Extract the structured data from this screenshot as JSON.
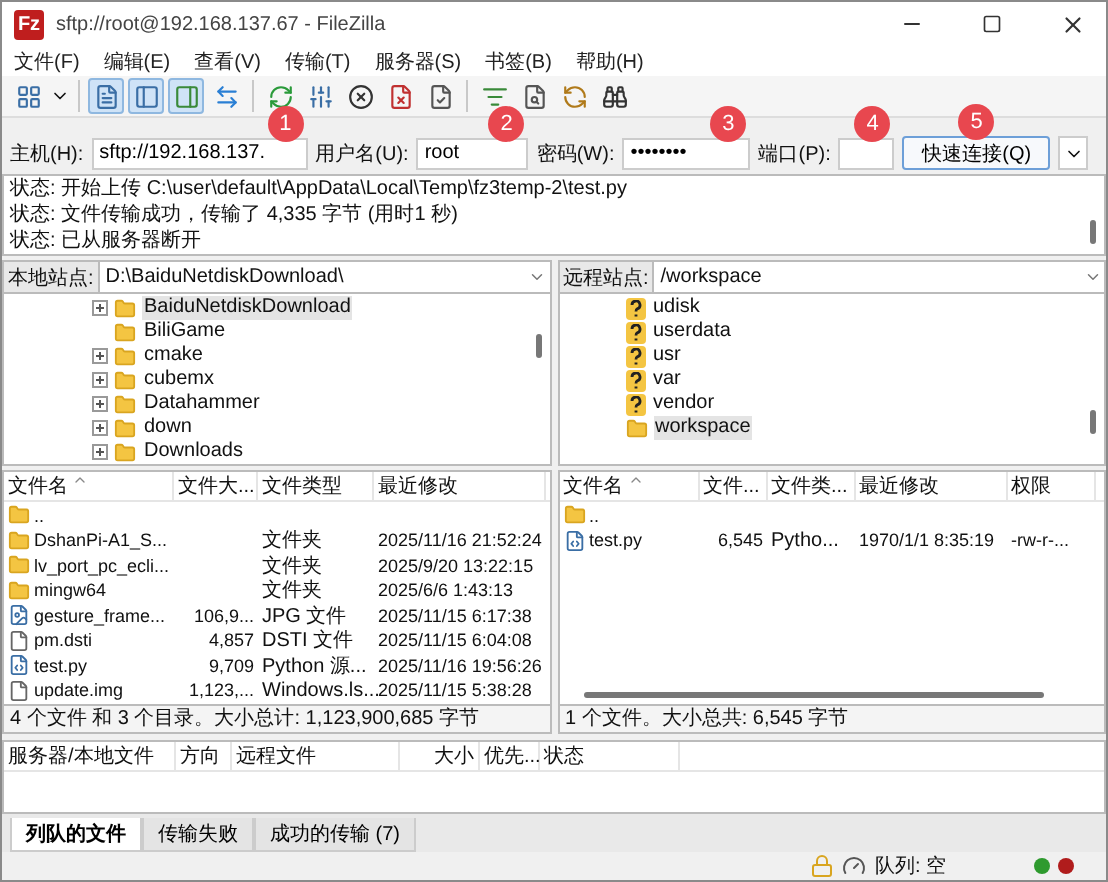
{
  "window": {
    "logo": "Fz",
    "title": "sftp://root@192.168.137.67 - FileZilla"
  },
  "menu": [
    "文件(F)",
    "编辑(E)",
    "查看(V)",
    "传输(T)",
    "服务器(S)",
    "书签(B)",
    "帮助(H)"
  ],
  "toolbar_toggles": [
    {
      "on": true
    },
    {
      "on": true
    },
    {
      "on": true
    },
    {
      "on": false
    }
  ],
  "quickconnect": {
    "host_label": "主机(H):",
    "host": "sftp://192.168.137.",
    "user_label": "用户名(U):",
    "user": "root",
    "password_label": "密码(W):",
    "password": "••••••••",
    "port_label": "端口(P):",
    "button": "快速连接(Q)"
  },
  "markers": [
    "1",
    "2",
    "3",
    "4",
    "5"
  ],
  "log": [
    "状态: 开始上传 C:\\user\\default\\AppData\\Local\\Temp\\fz3temp-2\\test.py",
    "状态: 文件传输成功，传输了 4,335 字节 (用时1 秒)",
    "状态: 已从服务器断开"
  ],
  "local": {
    "site_label": "本地站点:",
    "path": "D:\\BaiduNetdiskDownload\\",
    "tree": [
      {
        "kind": "folder",
        "name": "BaiduNetdiskDownload",
        "expandable": true,
        "selected": true
      },
      {
        "kind": "folder",
        "name": "BiliGame",
        "expandable": false,
        "selected": false
      },
      {
        "kind": "folder",
        "name": "cmake",
        "expandable": true,
        "selected": false
      },
      {
        "kind": "folder",
        "name": "cubemx",
        "expandable": true,
        "selected": false
      },
      {
        "kind": "folder",
        "name": "Datahammer",
        "expandable": true,
        "selected": false
      },
      {
        "kind": "folder",
        "name": "down",
        "expandable": true,
        "selected": false
      },
      {
        "kind": "folder",
        "name": "Downloads",
        "expandable": true,
        "selected": false
      }
    ],
    "columns": [
      "文件名",
      "文件大...",
      "文件类型",
      "最近修改"
    ],
    "files": [
      {
        "kind": "parent",
        "cells": [
          ".."
        ]
      },
      {
        "kind": "folder",
        "cells": [
          "DshanPi-A1_S...",
          "",
          "文件夹",
          "2025/11/16 21:52:24"
        ]
      },
      {
        "kind": "folder",
        "cells": [
          "lv_port_pc_ecli...",
          "",
          "文件夹",
          "2025/9/20 13:22:15"
        ]
      },
      {
        "kind": "folder",
        "cells": [
          "mingw64",
          "",
          "文件夹",
          "2025/6/6 1:43:13"
        ]
      },
      {
        "kind": "image",
        "cells": [
          "gesture_frame...",
          "106,9...",
          "JPG 文件",
          "2025/11/15 6:17:38"
        ]
      },
      {
        "kind": "file",
        "cells": [
          "pm.dsti",
          "4,857",
          "DSTI 文件",
          "2025/11/15 6:04:08"
        ]
      },
      {
        "kind": "script",
        "cells": [
          "test.py",
          "9,709",
          "Python 源...",
          "2025/11/16 19:56:26"
        ]
      },
      {
        "kind": "file",
        "cells": [
          "update.img",
          "1,123,...",
          "Windows.ls...",
          "2025/11/15 5:38:28"
        ]
      }
    ],
    "status": "4 个文件 和 3 个目录。大小总计: 1,123,900,685 字节"
  },
  "remote": {
    "site_label": "远程站点:",
    "path": "/workspace",
    "tree": [
      {
        "kind": "unknown",
        "name": "udisk",
        "expandable": false,
        "selected": false
      },
      {
        "kind": "unknown",
        "name": "userdata",
        "expandable": false,
        "selected": false
      },
      {
        "kind": "unknown",
        "name": "usr",
        "expandable": false,
        "selected": false
      },
      {
        "kind": "unknown",
        "name": "var",
        "expandable": false,
        "selected": false
      },
      {
        "kind": "unknown",
        "name": "vendor",
        "expandable": false,
        "selected": false
      },
      {
        "kind": "folder",
        "name": "workspace",
        "expandable": false,
        "selected": true
      }
    ],
    "columns": [
      "文件名",
      "文件...",
      "文件类...",
      "最近修改",
      "权限"
    ],
    "files": [
      {
        "kind": "parent",
        "cells": [
          ".."
        ]
      },
      {
        "kind": "script",
        "cells": [
          "test.py",
          "6,545",
          "Pytho...",
          "1970/1/1 8:35:19",
          "-rw-r-..."
        ]
      }
    ],
    "status": "1 个文件。大小总共: 6,545 字节"
  },
  "queue": {
    "columns": [
      "服务器/本地文件",
      "方向",
      "远程文件",
      "大小",
      "优先...",
      "状态"
    ],
    "tabs": [
      {
        "label": "列队的文件",
        "selected": true
      },
      {
        "label": "传输失败",
        "selected": false
      },
      {
        "label": "成功的传输 (7)",
        "selected": false
      }
    ]
  },
  "status_bar": {
    "queue": "队列: 空",
    "indicators": [
      {
        "color": "#2e9a2e"
      },
      {
        "color": "#b01c1c"
      }
    ]
  }
}
